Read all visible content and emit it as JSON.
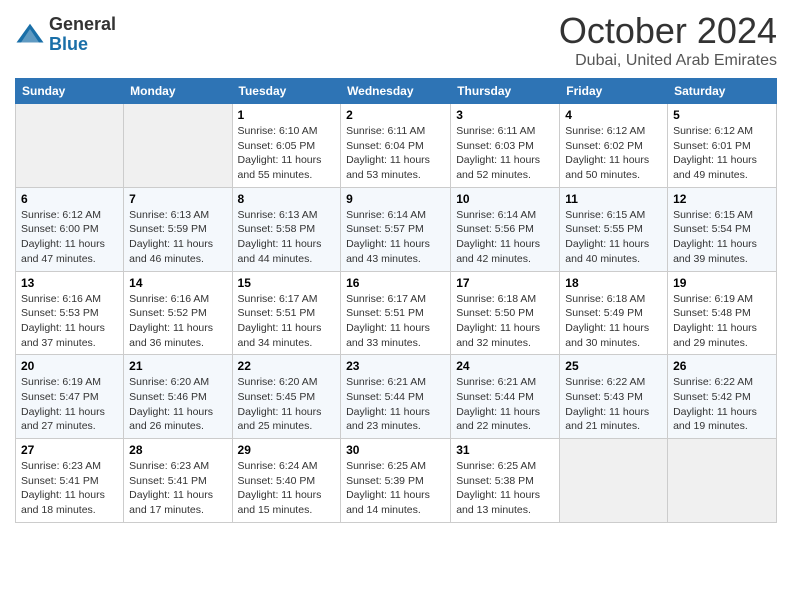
{
  "logo": {
    "general": "General",
    "blue": "Blue"
  },
  "title": "October 2024",
  "subtitle": "Dubai, United Arab Emirates",
  "days_of_week": [
    "Sunday",
    "Monday",
    "Tuesday",
    "Wednesday",
    "Thursday",
    "Friday",
    "Saturday"
  ],
  "weeks": [
    [
      {
        "day": "",
        "empty": true
      },
      {
        "day": "",
        "empty": true
      },
      {
        "day": "1",
        "sunrise": "Sunrise: 6:10 AM",
        "sunset": "Sunset: 6:05 PM",
        "daylight": "Daylight: 11 hours and 55 minutes."
      },
      {
        "day": "2",
        "sunrise": "Sunrise: 6:11 AM",
        "sunset": "Sunset: 6:04 PM",
        "daylight": "Daylight: 11 hours and 53 minutes."
      },
      {
        "day": "3",
        "sunrise": "Sunrise: 6:11 AM",
        "sunset": "Sunset: 6:03 PM",
        "daylight": "Daylight: 11 hours and 52 minutes."
      },
      {
        "day": "4",
        "sunrise": "Sunrise: 6:12 AM",
        "sunset": "Sunset: 6:02 PM",
        "daylight": "Daylight: 11 hours and 50 minutes."
      },
      {
        "day": "5",
        "sunrise": "Sunrise: 6:12 AM",
        "sunset": "Sunset: 6:01 PM",
        "daylight": "Daylight: 11 hours and 49 minutes."
      }
    ],
    [
      {
        "day": "6",
        "sunrise": "Sunrise: 6:12 AM",
        "sunset": "Sunset: 6:00 PM",
        "daylight": "Daylight: 11 hours and 47 minutes."
      },
      {
        "day": "7",
        "sunrise": "Sunrise: 6:13 AM",
        "sunset": "Sunset: 5:59 PM",
        "daylight": "Daylight: 11 hours and 46 minutes."
      },
      {
        "day": "8",
        "sunrise": "Sunrise: 6:13 AM",
        "sunset": "Sunset: 5:58 PM",
        "daylight": "Daylight: 11 hours and 44 minutes."
      },
      {
        "day": "9",
        "sunrise": "Sunrise: 6:14 AM",
        "sunset": "Sunset: 5:57 PM",
        "daylight": "Daylight: 11 hours and 43 minutes."
      },
      {
        "day": "10",
        "sunrise": "Sunrise: 6:14 AM",
        "sunset": "Sunset: 5:56 PM",
        "daylight": "Daylight: 11 hours and 42 minutes."
      },
      {
        "day": "11",
        "sunrise": "Sunrise: 6:15 AM",
        "sunset": "Sunset: 5:55 PM",
        "daylight": "Daylight: 11 hours and 40 minutes."
      },
      {
        "day": "12",
        "sunrise": "Sunrise: 6:15 AM",
        "sunset": "Sunset: 5:54 PM",
        "daylight": "Daylight: 11 hours and 39 minutes."
      }
    ],
    [
      {
        "day": "13",
        "sunrise": "Sunrise: 6:16 AM",
        "sunset": "Sunset: 5:53 PM",
        "daylight": "Daylight: 11 hours and 37 minutes."
      },
      {
        "day": "14",
        "sunrise": "Sunrise: 6:16 AM",
        "sunset": "Sunset: 5:52 PM",
        "daylight": "Daylight: 11 hours and 36 minutes."
      },
      {
        "day": "15",
        "sunrise": "Sunrise: 6:17 AM",
        "sunset": "Sunset: 5:51 PM",
        "daylight": "Daylight: 11 hours and 34 minutes."
      },
      {
        "day": "16",
        "sunrise": "Sunrise: 6:17 AM",
        "sunset": "Sunset: 5:51 PM",
        "daylight": "Daylight: 11 hours and 33 minutes."
      },
      {
        "day": "17",
        "sunrise": "Sunrise: 6:18 AM",
        "sunset": "Sunset: 5:50 PM",
        "daylight": "Daylight: 11 hours and 32 minutes."
      },
      {
        "day": "18",
        "sunrise": "Sunrise: 6:18 AM",
        "sunset": "Sunset: 5:49 PM",
        "daylight": "Daylight: 11 hours and 30 minutes."
      },
      {
        "day": "19",
        "sunrise": "Sunrise: 6:19 AM",
        "sunset": "Sunset: 5:48 PM",
        "daylight": "Daylight: 11 hours and 29 minutes."
      }
    ],
    [
      {
        "day": "20",
        "sunrise": "Sunrise: 6:19 AM",
        "sunset": "Sunset: 5:47 PM",
        "daylight": "Daylight: 11 hours and 27 minutes."
      },
      {
        "day": "21",
        "sunrise": "Sunrise: 6:20 AM",
        "sunset": "Sunset: 5:46 PM",
        "daylight": "Daylight: 11 hours and 26 minutes."
      },
      {
        "day": "22",
        "sunrise": "Sunrise: 6:20 AM",
        "sunset": "Sunset: 5:45 PM",
        "daylight": "Daylight: 11 hours and 25 minutes."
      },
      {
        "day": "23",
        "sunrise": "Sunrise: 6:21 AM",
        "sunset": "Sunset: 5:44 PM",
        "daylight": "Daylight: 11 hours and 23 minutes."
      },
      {
        "day": "24",
        "sunrise": "Sunrise: 6:21 AM",
        "sunset": "Sunset: 5:44 PM",
        "daylight": "Daylight: 11 hours and 22 minutes."
      },
      {
        "day": "25",
        "sunrise": "Sunrise: 6:22 AM",
        "sunset": "Sunset: 5:43 PM",
        "daylight": "Daylight: 11 hours and 21 minutes."
      },
      {
        "day": "26",
        "sunrise": "Sunrise: 6:22 AM",
        "sunset": "Sunset: 5:42 PM",
        "daylight": "Daylight: 11 hours and 19 minutes."
      }
    ],
    [
      {
        "day": "27",
        "sunrise": "Sunrise: 6:23 AM",
        "sunset": "Sunset: 5:41 PM",
        "daylight": "Daylight: 11 hours and 18 minutes."
      },
      {
        "day": "28",
        "sunrise": "Sunrise: 6:23 AM",
        "sunset": "Sunset: 5:41 PM",
        "daylight": "Daylight: 11 hours and 17 minutes."
      },
      {
        "day": "29",
        "sunrise": "Sunrise: 6:24 AM",
        "sunset": "Sunset: 5:40 PM",
        "daylight": "Daylight: 11 hours and 15 minutes."
      },
      {
        "day": "30",
        "sunrise": "Sunrise: 6:25 AM",
        "sunset": "Sunset: 5:39 PM",
        "daylight": "Daylight: 11 hours and 14 minutes."
      },
      {
        "day": "31",
        "sunrise": "Sunrise: 6:25 AM",
        "sunset": "Sunset: 5:38 PM",
        "daylight": "Daylight: 11 hours and 13 minutes."
      },
      {
        "day": "",
        "empty": true
      },
      {
        "day": "",
        "empty": true
      }
    ]
  ]
}
